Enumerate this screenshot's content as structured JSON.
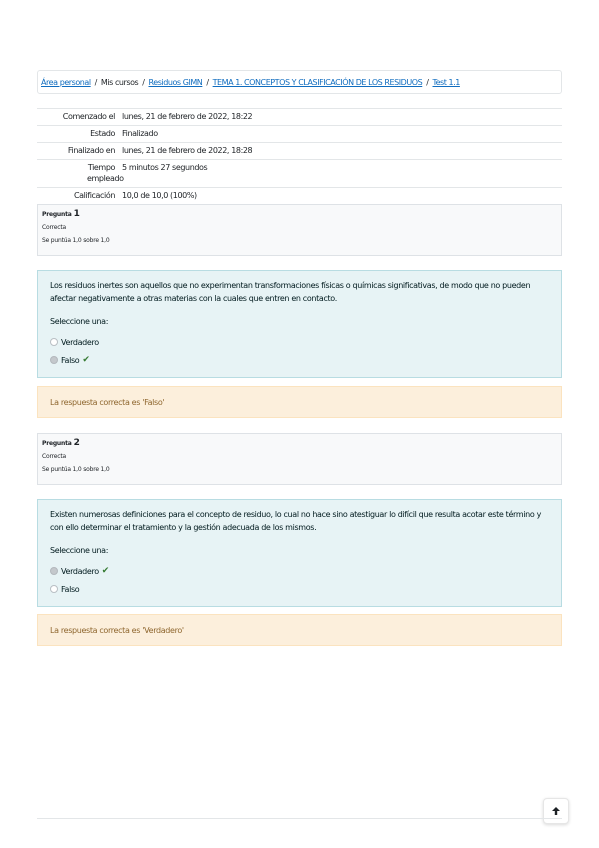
{
  "breadcrumb": {
    "items": [
      "Área personal",
      "Mis cursos",
      "Residuos GIMN",
      "TEMA 1. CONCEPTOS Y CLASIFICACIÓN DE LOS RESIDUOS",
      "Test 1.1"
    ],
    "separator": "/"
  },
  "summary": [
    {
      "label": "Comenzado el",
      "value": "lunes, 21 de febrero de 2022, 18:22"
    },
    {
      "label": "Estado",
      "value": "Finalizado"
    },
    {
      "label": "Finalizado en",
      "value": "lunes, 21 de febrero de 2022, 18:28"
    },
    {
      "label": "Tiempo empleado",
      "value": "5 minutos 27 segundos"
    },
    {
      "label": "Calificación",
      "value": "10,0 de 10,0 (100%)"
    }
  ],
  "questions": [
    {
      "label": "Pregunta",
      "number": "1",
      "state": "Correcta",
      "grade": "Se puntúa 1,0 sobre 1,0",
      "text": "Los residuos inertes son aquellos que no experimentan transformaciones físicas o químicas significativas, de modo que no pueden afectar negativamente a otras materias con la cuales que entren en contacto.",
      "prompt": "Seleccione una:",
      "options": [
        "Verdadero",
        "Falso"
      ],
      "selected": "Falso",
      "feedback": "La respuesta correcta es 'Falso'"
    },
    {
      "label": "Pregunta",
      "number": "2",
      "state": "Correcta",
      "grade": "Se puntúa 1,0 sobre 1,0",
      "text": "Existen numerosas definiciones para el concepto de residuo, lo cual no hace sino atestiguar lo difícil que resulta acotar este término y con ello determinar el tratamiento y la gestión adecuada de los mismos.",
      "prompt": "Seleccione una:",
      "options": [
        "Verdadero",
        "Falso"
      ],
      "selected": "Verdadero",
      "feedback": "La respuesta correcta es 'Verdadero'"
    }
  ],
  "icons": {
    "correct": "check-icon",
    "back_to_top": "arrow-up-icon"
  },
  "colors": {
    "link": "#0f6cbf",
    "correct": "#357a32",
    "feedback_text": "#8e662e",
    "formulation_bg": "#e7f3f5",
    "feedback_bg": "#fcefdc"
  },
  "top_button_glyph": "🠕"
}
